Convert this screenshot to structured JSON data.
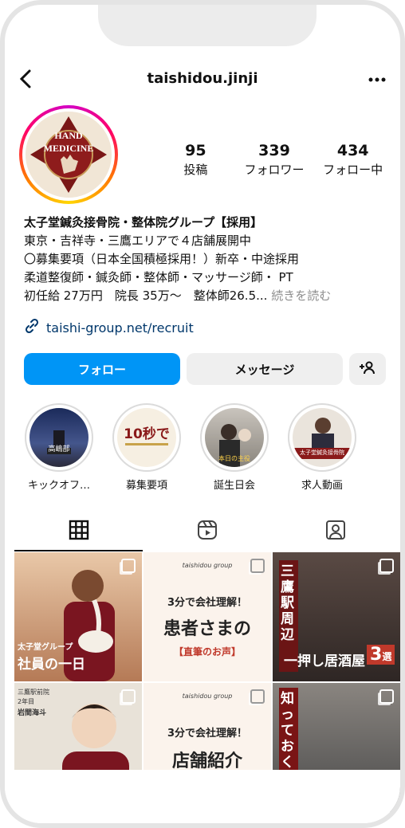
{
  "header": {
    "username": "taishidou.jinji",
    "back_icon": "chevron-left-icon",
    "menu_icon": "more-horizontal-icon"
  },
  "profile": {
    "avatar_text_top": "HAND",
    "avatar_text_bottom": "MEDICINE",
    "stats": [
      {
        "num": "95",
        "label": "投稿"
      },
      {
        "num": "339",
        "label": "フォロワー"
      },
      {
        "num": "434",
        "label": "フォロー中"
      }
    ],
    "bio": {
      "name": "太子堂鍼灸接骨院・整体院グループ【採用】",
      "line1": "東京・吉祥寺・三鷹エリアで４店舗展開中",
      "line2": "〇募集要項（日本全国積極採用！）新卒・中途採用",
      "line3": "柔道整復師・鍼灸師・整体師・マッサージ師・ PT",
      "line4": "初任給 27万円　院長 35万〜　整体師26.5...",
      "more": " 続きを読む"
    },
    "link": "taishi-group.net/recruit"
  },
  "actions": {
    "follow": "フォロー",
    "message": "メッセージ"
  },
  "highlights": [
    {
      "label": "キックオフ…",
      "inner_text": "高嶋部"
    },
    {
      "label": "募集要項",
      "inner_text": "10秒で"
    },
    {
      "label": "誕生日会",
      "inner_text": "本日の主役"
    },
    {
      "label": "求人動画",
      "inner_text": "太子堂鍼灸接骨院"
    }
  ],
  "posts": [
    {
      "top": "太子堂グループ",
      "main": "社員の一日"
    },
    {
      "brand": "taishidou group",
      "lead": "3分で会社理解！",
      "main": "患者さまの",
      "sub": "【直筆のお声】"
    },
    {
      "vertical": "三鷹駅周辺",
      "main": "一押し居酒屋",
      "badge": "3",
      "badge_suffix": "選"
    },
    {
      "top1": "三鷹駅前院",
      "top2": "2年目",
      "top3": "岩間海斗"
    },
    {
      "brand": "taishidou group",
      "lead": "3分で会社理解！",
      "main": "店舗紹介"
    },
    {
      "vertical": "知っておくべき"
    }
  ]
}
